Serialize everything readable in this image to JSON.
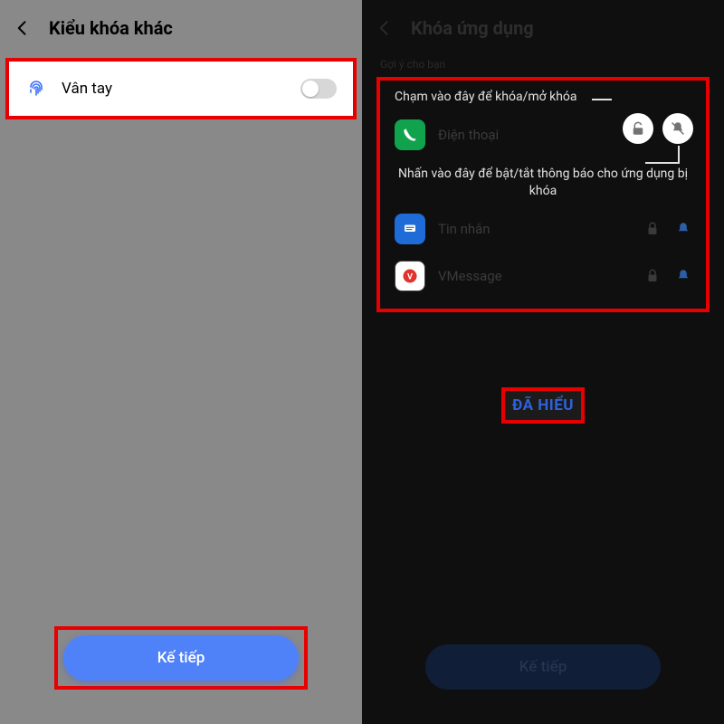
{
  "left": {
    "title": "Kiểu khóa khác",
    "fingerprint_label": "Vân tay",
    "next_label": "Kế tiếp"
  },
  "right": {
    "title": "Khóa ứng dụng",
    "suggestion_header": "Gợi ý cho bạn",
    "tip_lock": "Chạm vào đây để khóa/mở khóa",
    "tip_notify": "Nhấn vào đây để bật/tắt thông báo cho ứng dụng bị khóa",
    "apps": {
      "phone": "Điện thoại",
      "messages": "Tin nhắn",
      "vmessage": "VMessage"
    },
    "ok_label": "ĐÃ HIỂU",
    "next_dim_label": "Kế tiếp"
  },
  "colors": {
    "highlight": "#e80000",
    "primary_button": "#4f82f9",
    "ok_text": "#2f62da"
  }
}
